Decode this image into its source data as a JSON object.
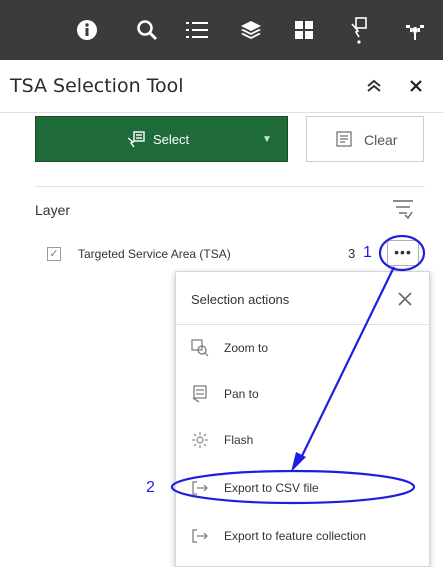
{
  "toolbar": {
    "icons": [
      "info-icon",
      "search-icon",
      "list-icon",
      "layers-icon",
      "grid-icon",
      "select-tool-icon",
      "tools-icon"
    ]
  },
  "header": {
    "title": "TSA Selection Tool"
  },
  "actions_bar": {
    "select_label": "Select",
    "clear_label": "Clear"
  },
  "layer_section": {
    "heading": "Layer",
    "layer_name": "Targeted Service Area (TSA)",
    "count": "3"
  },
  "popup": {
    "title": "Selection actions",
    "actions": [
      {
        "label": "Zoom to",
        "icon": "zoom-to-icon"
      },
      {
        "label": "Pan to",
        "icon": "pan-to-icon"
      },
      {
        "label": "Flash",
        "icon": "flash-icon"
      },
      {
        "label": "Export to CSV file",
        "icon": "export-icon"
      },
      {
        "label": "Export to feature collection",
        "icon": "export-icon"
      }
    ]
  },
  "annotations": {
    "step1": "1",
    "step2": "2",
    "color": "#1e1ee0"
  },
  "colors": {
    "toolbar_bg": "#3b3b3b",
    "primary_button": "#1f6b3a"
  }
}
